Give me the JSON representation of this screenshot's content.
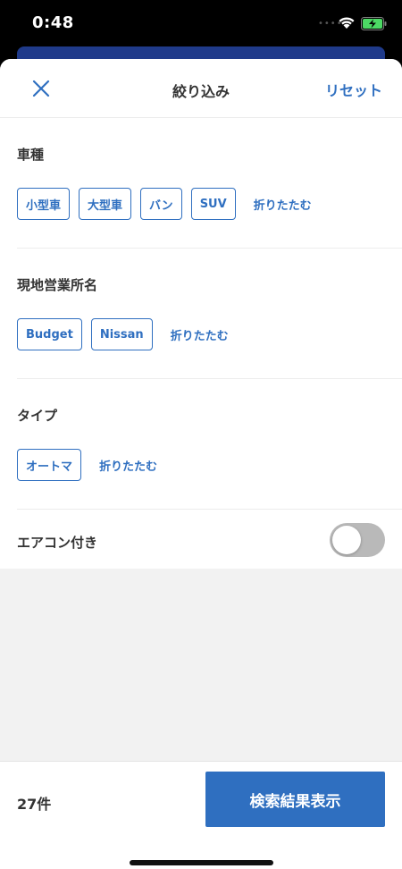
{
  "status": {
    "time": "0:48",
    "signal_icon": "signal-dots-icon",
    "wifi_icon": "wifi-icon",
    "battery_icon": "battery-charging-icon"
  },
  "nav": {
    "close_icon": "close-icon",
    "title": "絞り込み",
    "reset_label": "リセット"
  },
  "sections": {
    "vehicle_type": {
      "title": "車種",
      "chips": [
        "小型車",
        "大型車",
        "バン",
        "SUV"
      ],
      "collapse_label": "折りたたむ"
    },
    "office": {
      "title": "現地営業所名",
      "chips": [
        "Budget",
        "Nissan"
      ],
      "collapse_label": "折りたたむ"
    },
    "type": {
      "title": "タイプ",
      "chips": [
        "オートマ"
      ],
      "collapse_label": "折りたたむ"
    },
    "aircon": {
      "title": "エアコン付き",
      "toggle_on": false
    }
  },
  "footer": {
    "count": "27件",
    "search_label": "検索結果表示"
  },
  "colors": {
    "accent": "#2f6fc0",
    "toggle_off": "#b9b9b9",
    "behind_header": "#1f3a8a"
  }
}
